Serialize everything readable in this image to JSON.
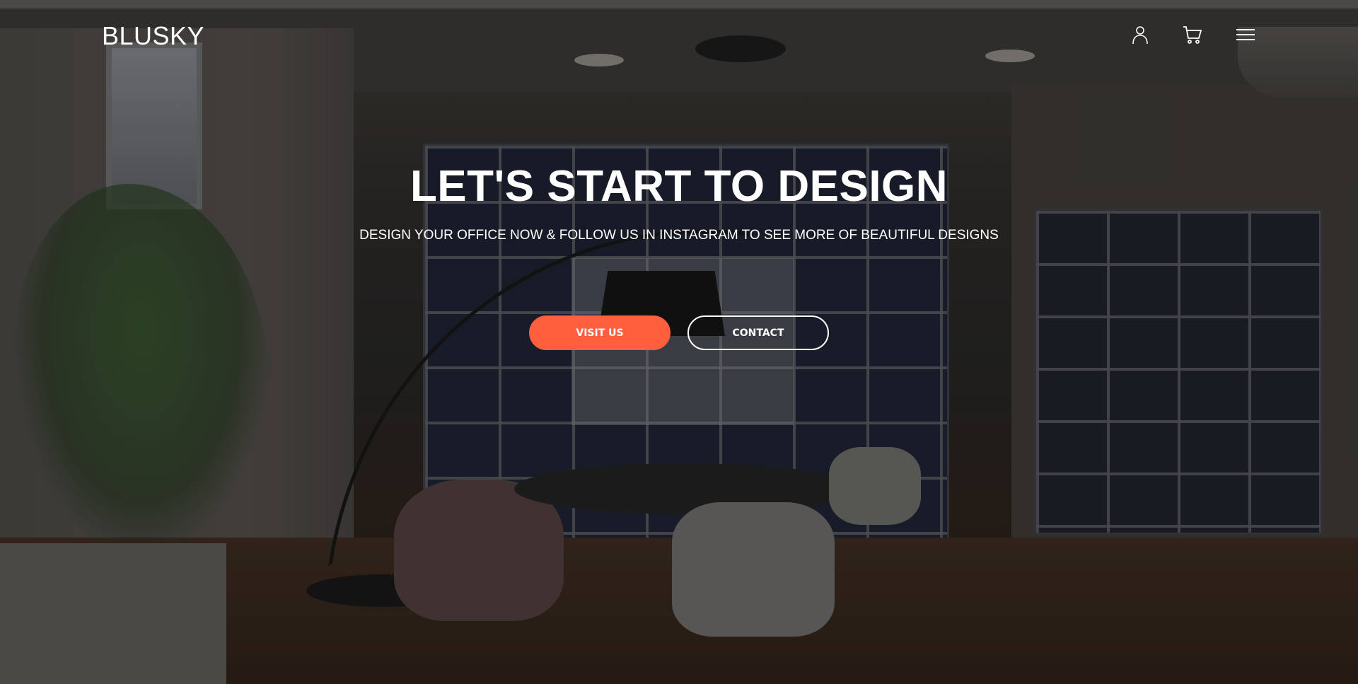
{
  "header": {
    "logo": "BLUSKY",
    "icons": [
      "user-icon",
      "cart-icon",
      "menu-icon"
    ]
  },
  "hero": {
    "title": "LET'S START TO DESIGN",
    "subtitle": "DESIGN YOUR OFFICE NOW & FOLLOW US IN INSTAGRAM TO SEE MORE OF BEAUTIFUL DESIGNS",
    "buttons": {
      "primary": "VISIT US",
      "secondary": "CONTACT"
    }
  },
  "colors": {
    "accent": "#ff5f3d",
    "text": "#ffffff"
  }
}
